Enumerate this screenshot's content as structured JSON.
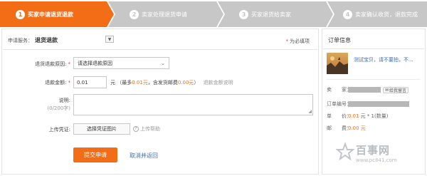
{
  "steps": [
    {
      "num": "1",
      "label": "买家申请退货退款",
      "state": "active"
    },
    {
      "num": "2",
      "label": "卖家处理退货申请",
      "state": "inactive"
    },
    {
      "num": "3",
      "label": "买家退货给卖家",
      "state": "inactive"
    },
    {
      "num": "4",
      "label": "卖家确认收货，退款完成",
      "state": "inactive"
    }
  ],
  "form": {
    "service_label": "申请服务：",
    "service_value": "退货退款",
    "required_note": "为必填项",
    "reason_label": "退货退款原因:",
    "reason_value": "请选择退款原因",
    "amount_label": "退款金额:",
    "amount_value": "0.01",
    "amount_unit": "元",
    "amount_hint_prefix": "（最多",
    "amount_max": "0.01元",
    "amount_hint_middle": "，含发货邮费",
    "amount_shipping": "0.00元",
    "amount_hint_suffix": "）",
    "amount_help": "退款金额说明",
    "desc_label": "说明:",
    "desc_counter": "(0/200字)",
    "upload_label": "上传凭证:",
    "upload_button": "选择凭证图片",
    "upload_help": "上传帮助",
    "submit": "提交申请",
    "cancel": "取消并返回"
  },
  "order": {
    "title": "订单信息",
    "product_name": "测试宝贝，请不要拍，不...",
    "seller_key": "卖　　家：",
    "chat_label": "给我留言",
    "order_no_key": "订单编号：",
    "price_key": "单　　价：",
    "price_value": "0.01",
    "price_suffix": "元 * 1(数量)",
    "shipping_key": "邮　　费：",
    "shipping_value": "0.00 元"
  },
  "watermark": {
    "title": "百事网",
    "url": "www.pc841.com"
  },
  "colors": {
    "accent": "#f36d17",
    "inactive_step": "#c7c7c7",
    "link": "#3e6cb8",
    "required": "#e4393c"
  }
}
